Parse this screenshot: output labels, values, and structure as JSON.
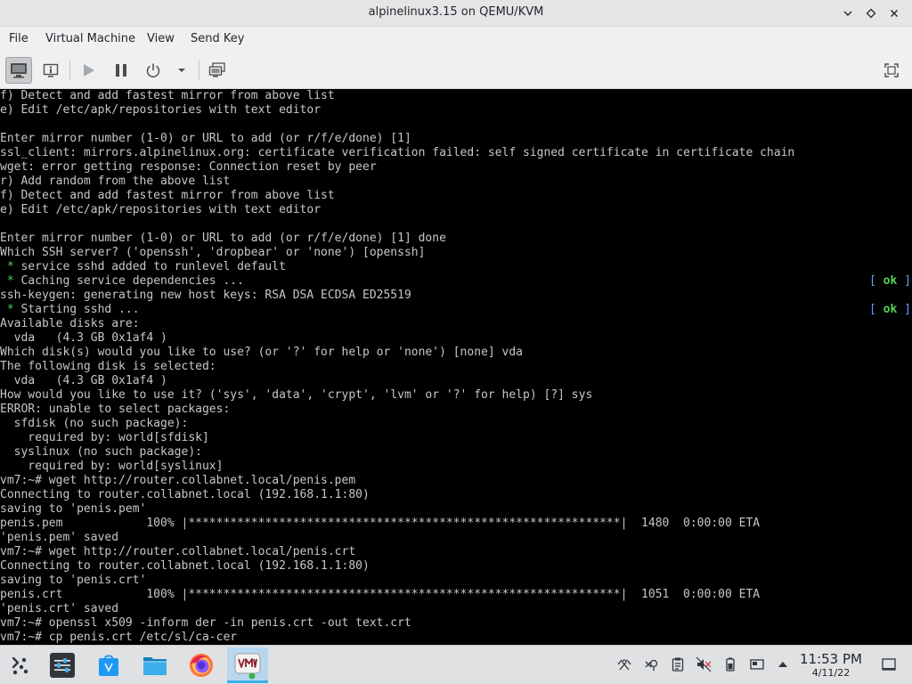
{
  "window": {
    "title": "alpinelinux3.15 on QEMU/KVM",
    "controls": [
      "chevron-down-icon",
      "restore-diamond-icon",
      "close-icon"
    ]
  },
  "menu": [
    "File",
    "Virtual Machine",
    "View",
    "Send Key"
  ],
  "toolbar": [
    "console-view-icon",
    "details-info-icon",
    "play-icon",
    "pause-icon",
    "power-icon",
    "chevron-down-icon",
    "snapshots-icon",
    "fullscreen-icon"
  ],
  "console": {
    "lines": [
      "f) Detect and add fastest mirror from above list",
      "e) Edit /etc/apk/repositories with text editor",
      "",
      "Enter mirror number (1-0) or URL to add (or r/f/e/done) [1]",
      "ssl_client: mirrors.alpinelinux.org: certificate verification failed: self signed certificate in certificate chain",
      "wget: error getting response: Connection reset by peer",
      "r) Add random from the above list",
      "f) Detect and add fastest mirror from above list",
      "e) Edit /etc/apk/repositories with text editor",
      "",
      "Enter mirror number (1-0) or URL to add (or r/f/e/done) [1] done",
      "Which SSH server? ('openssh', 'dropbear' or 'none') [openssh]",
      "",
      "",
      "ssh-keygen: generating new host keys: RSA DSA ECDSA ED25519",
      "",
      "Available disks are:",
      "  vda   (4.3 GB 0x1af4 )",
      "Which disk(s) would you like to use? (or '?' for help or 'none') [none] vda",
      "The following disk is selected:",
      "  vda   (4.3 GB 0x1af4 )",
      "How would you like to use it? ('sys', 'data', 'crypt', 'lvm' or '?' for help) [?] sys",
      "ERROR: unable to select packages:",
      "  sfdisk (no such package):",
      "    required by: world[sfdisk]",
      "  syslinux (no such package):",
      "    required by: world[syslinux]",
      "vm7:~# wget http://router.collabnet.local/penis.pem",
      "Connecting to router.collabnet.local (192.168.1.1:80)",
      "saving to 'penis.pem'",
      "penis.pem            100% |**************************************************************|  1480  0:00:00 ETA",
      "'penis.pem' saved",
      "vm7:~# wget http://router.collabnet.local/penis.crt",
      "Connecting to router.collabnet.local (192.168.1.1:80)",
      "saving to 'penis.crt'",
      "penis.crt            100% |**************************************************************|  1051  0:00:00 ETA",
      "'penis.crt' saved",
      "vm7:~# openssl x509 -inform der -in penis.crt -out text.crt",
      "vm7:~# cp penis.crt /etc/sl/ca-cer"
    ],
    "service_lines": [
      {
        "index": 12,
        "star": " *",
        "text": " service sshd added to runlevel default",
        "status_open": "",
        "status": "",
        "status_close": ""
      },
      {
        "index": 13,
        "star": " *",
        "text": " Caching service dependencies ...",
        "status_open": "[ ",
        "status": "ok",
        "status_close": " ]"
      },
      {
        "index": 15,
        "star": " *",
        "text": " Starting sshd ...",
        "status_open": "[ ",
        "status": "ok",
        "status_close": " ]"
      }
    ]
  },
  "taskbar": {
    "apps": [
      "app-launcher-icon",
      "system-settings-icon",
      "discover-store-icon",
      "file-manager-icon",
      "firefox-icon",
      "virt-manager-icon"
    ],
    "active_app": "virt-manager-icon",
    "tray": [
      "accessibility-icon",
      "vault-icon",
      "clipboard-icon",
      "volume-muted-icon",
      "battery-icon",
      "display-icon",
      "tray-expand-icon"
    ],
    "time": "11:53 PM",
    "date": "4/11/22",
    "show_desktop": "show-desktop-icon"
  }
}
